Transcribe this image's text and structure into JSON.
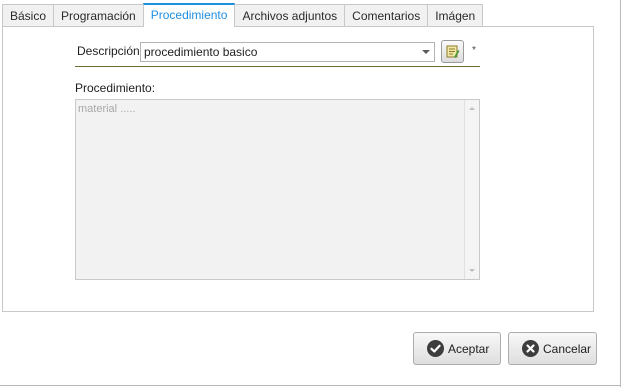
{
  "tabs": [
    {
      "label": "Básico",
      "active": false
    },
    {
      "label": "Programación",
      "active": false
    },
    {
      "label": "Procedimiento",
      "active": true
    },
    {
      "label": "Archivos adjuntos",
      "active": false
    },
    {
      "label": "Comentarios",
      "active": false
    },
    {
      "label": "Imágen",
      "active": false
    }
  ],
  "form": {
    "description_label": "Descripción:",
    "description_value": "procedimiento basico",
    "required_mark": "*",
    "procedure_label": "Procedimiento:",
    "procedure_text": "material ....."
  },
  "buttons": {
    "accept": "Aceptar",
    "cancel": "Cancelar"
  },
  "icons": {
    "dropdown": "chevron-down-icon",
    "edit": "edit-note-icon",
    "accept": "check-circle-icon",
    "cancel": "close-circle-icon"
  },
  "colors": {
    "active_tab": "#1f8fe0",
    "underline": "#6b6b33"
  }
}
